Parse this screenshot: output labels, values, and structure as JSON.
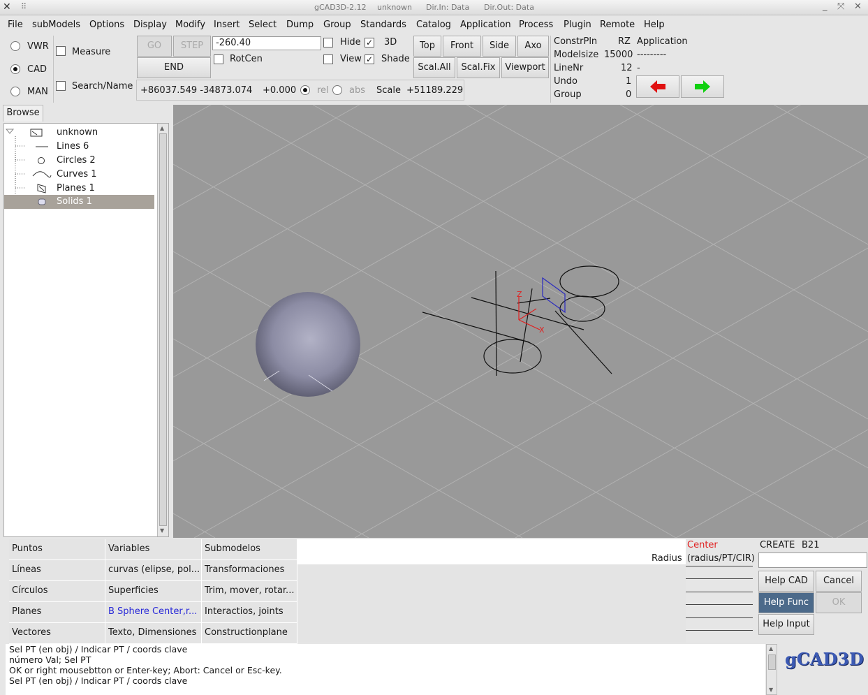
{
  "titlebar": {
    "app": "gCAD3D-2.12",
    "model": "unknown",
    "dir_in": "Dir.In: Data",
    "dir_out": "Dir.Out: Data"
  },
  "menu": [
    "File",
    "subModels",
    "Options",
    "Display",
    "Modify",
    "Insert",
    "Select",
    "Dump",
    "Group",
    "Standards",
    "Catalog",
    "Application",
    "Process",
    "Plugin",
    "Remote",
    "Help"
  ],
  "modes": {
    "vwr": "VWR",
    "cad": "CAD",
    "man": "MAN",
    "selected": "CAD"
  },
  "checks": {
    "measure": "Measure",
    "search": "Search/Name",
    "rotcen": "RotCen",
    "hide": "Hide",
    "view": "View",
    "three_d": "3D",
    "shade": "Shade"
  },
  "buttons": {
    "go": "GO",
    "step": "STEP",
    "end": "END",
    "top": "Top",
    "front": "Front",
    "side": "Side",
    "axo": "Axo",
    "scal_all": "Scal.All",
    "scal_fix": "Scal.Fix",
    "viewport": "Viewport"
  },
  "input_value": "-260.40",
  "coords": {
    "xy": "+86037.549 -34873.074",
    "z": "+0.000",
    "rel": "rel",
    "abs": "abs",
    "scale_label": "Scale",
    "scale_value": "+51189.229"
  },
  "info": {
    "constr_label": "ConstrPln",
    "constr_value": "RZ",
    "constr_extra": "Application",
    "modelsize_label": "Modelsize",
    "modelsize_value": "15000",
    "modelsize_extra": "---------",
    "linenr_label": "LineNr",
    "linenr_value": "12",
    "linenr_extra": "-",
    "undo_label": "Undo",
    "undo_value": "1",
    "group_label": "Group",
    "group_value": "0"
  },
  "browse_tab": "Browse",
  "tree": [
    {
      "label": "unknown",
      "icon": "model-icon"
    },
    {
      "label": "Lines 6",
      "icon": "line-icon"
    },
    {
      "label": "Circles 2",
      "icon": "circle-icon"
    },
    {
      "label": "Curves 1",
      "icon": "curve-icon"
    },
    {
      "label": "Planes 1",
      "icon": "plane-icon"
    },
    {
      "label": "Solids 1",
      "icon": "solid-icon",
      "selected": true
    }
  ],
  "grid": [
    [
      "Puntos",
      "Variables",
      "Submodelos"
    ],
    [
      "Líneas",
      "curvas (elipse, pol...",
      "Transformaciones"
    ],
    [
      "Círculos",
      "Superficies",
      "Trim, mover, rotar..."
    ],
    [
      "Planes",
      "B Sphere Center,r...",
      "Interactios, joints"
    ],
    [
      "Vectores",
      "Texto, Dimensiones",
      "Constructionplane"
    ]
  ],
  "params": {
    "center": "Center",
    "radius_label": "Radius",
    "radius_hint": "(radius/PT/CIR)"
  },
  "create": {
    "label": "CREATE",
    "id": "B21"
  },
  "side_buttons": {
    "help_cad": "Help CAD",
    "cancel": "Cancel",
    "help_func": "Help Func",
    "ok": "OK",
    "help_input": "Help Input"
  },
  "messages": [
    "Sel PT (en obj) / Indicar PT / coords clave",
    "número Val; Sel PT",
    "OK or right mousebtton or Enter-key; Abort: Cancel or Esc-key.",
    "Sel PT (en obj) / Indicar PT / coords clave"
  ],
  "logo": "gCAD3D",
  "colors": {
    "center_red": "#e02020",
    "help_func_bg": "#4c6a8a",
    "blue_row": "#2a2ad8"
  }
}
